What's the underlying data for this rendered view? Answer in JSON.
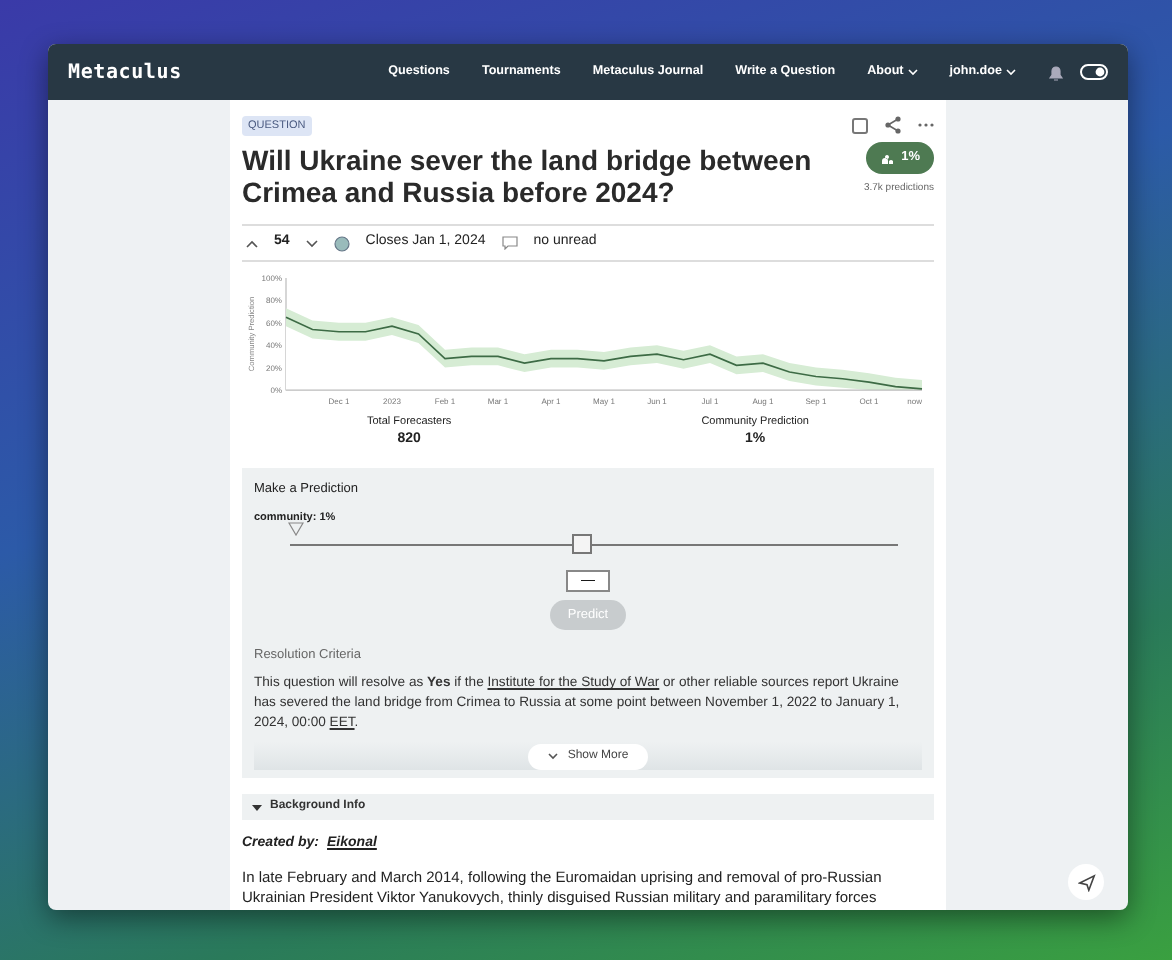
{
  "navbar": {
    "logo": "Metaculus",
    "links": [
      {
        "label": "Questions",
        "dropdown": false
      },
      {
        "label": "Tournaments",
        "dropdown": false
      },
      {
        "label": "Metaculus Journal",
        "dropdown": false
      },
      {
        "label": "Write a Question",
        "dropdown": false
      },
      {
        "label": "About",
        "dropdown": true
      },
      {
        "label": "john.doe",
        "dropdown": true
      }
    ]
  },
  "question": {
    "tag": "QUESTION",
    "title": "Will Ukraine sever the land bridge between Crimea and Russia before 2024?",
    "community_badge": "1%",
    "predictions": "3.7k predictions",
    "votes": "54",
    "closes": "Closes Jan 1, 2024",
    "comments": "no unread",
    "chart_data": {
      "type": "line",
      "ylabel": "Community Prediction",
      "ylim": [
        0,
        1
      ],
      "categories": [
        null,
        null,
        "Dec 1",
        null,
        "2023",
        null,
        "Feb 1",
        null,
        "Mar 1",
        null,
        "Apr 1",
        null,
        "May 1",
        null,
        "Jun 1",
        null,
        "Jul 1",
        null,
        "Aug 1",
        null,
        "Sep 1",
        null,
        "Oct 1",
        null,
        "now"
      ],
      "series": [
        {
          "color": "#3d6b45",
          "values": [
            0.65,
            0.54,
            0.52,
            0.52,
            0.57,
            0.5,
            0.28,
            0.3,
            0.3,
            0.24,
            0.28,
            0.28,
            0.26,
            0.3,
            0.32,
            0.27,
            0.32,
            0.22,
            0.24,
            0.16,
            0.12,
            0.1,
            0.07,
            0.03,
            0.01
          ]
        },
        {
          "type": "area",
          "color": "#d6ecd4",
          "values": [
            0.73,
            0.62,
            0.6,
            0.6,
            0.65,
            0.58,
            0.36,
            0.38,
            0.38,
            0.32,
            0.36,
            0.36,
            0.34,
            0.38,
            0.4,
            0.35,
            0.4,
            0.3,
            0.32,
            0.24,
            0.2,
            0.18,
            0.15,
            0.11,
            0.09
          ]
        },
        {
          "type": "area",
          "color": "#ffffff",
          "values": [
            0.57,
            0.46,
            0.44,
            0.44,
            0.49,
            0.42,
            0.2,
            0.22,
            0.22,
            0.16,
            0.2,
            0.2,
            0.18,
            0.22,
            0.24,
            0.19,
            0.24,
            0.14,
            0.16,
            0.08,
            0.04,
            0.02,
            0,
            0,
            0
          ]
        }
      ],
      "yticks": [
        {
          "value": 0,
          "label": "0%"
        },
        {
          "value": 0.2,
          "label": "20%"
        },
        {
          "value": 0.4,
          "label": "40%"
        },
        {
          "value": 0.6,
          "label": "60%"
        },
        {
          "value": 0.8,
          "label": "80%"
        },
        {
          "value": 1,
          "label": "100%"
        }
      ]
    },
    "stats": [
      {
        "label": "Total Forecasters",
        "value": "820"
      },
      {
        "label": "Community Prediction",
        "value": "1%"
      }
    ]
  },
  "prediction": {
    "heading": "Make a Prediction",
    "community_label": "community: 1%",
    "community_marker": {
      "level": 0.01
    },
    "level": 0.48,
    "input_value": "—",
    "button": "Predict",
    "button_disabled": true
  },
  "resolution": {
    "heading": "Resolution Criteria",
    "parts": [
      {
        "kind": "text",
        "text": "This question will resolve as **Yes** if the "
      },
      {
        "kind": "link",
        "text": "Institute for the Study of War"
      },
      {
        "kind": "text",
        "text": " or other reliable sources report Ukraine has severed the land bridge from Crimea to Russia at some point between November 1, 2022 to January 1, 2024, 00:00 "
      },
      {
        "kind": "link",
        "text": "EET"
      },
      {
        "kind": "text",
        "text": "."
      }
    ],
    "show_more": "Show More"
  },
  "background": {
    "heading": "Background Info",
    "expanded": true,
    "created_label": "Created by:",
    "author": "Eikonal",
    "text": "In late February and March 2014, following the Euromaidan uprising and removal of pro-Russian Ukrainian President Viktor Yanukovych, thinly disguised Russian military and paramilitary forces"
  }
}
